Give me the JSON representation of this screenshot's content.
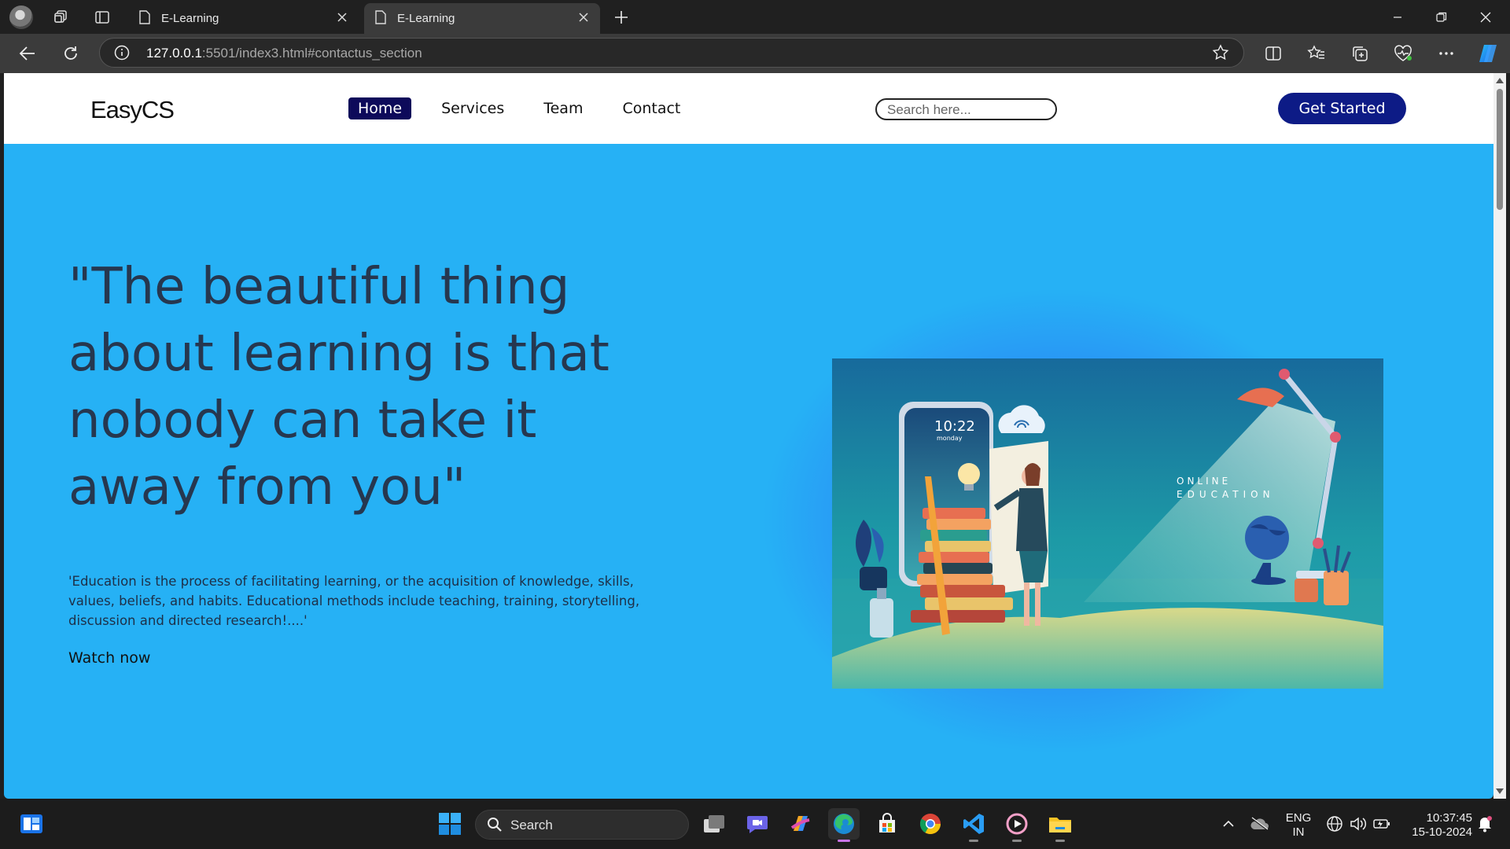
{
  "browser": {
    "tabs": [
      {
        "title": "E-Learning",
        "active": false
      },
      {
        "title": "E-Learning",
        "active": true
      }
    ],
    "address": {
      "host": "127.0.0.1",
      "rest": ":5501/index3.html#contactus_section"
    }
  },
  "site": {
    "logo": "EasyCS",
    "menu": [
      {
        "label": "Home",
        "active": true
      },
      {
        "label": "Services",
        "active": false
      },
      {
        "label": "Team",
        "active": false
      },
      {
        "label": "Contact",
        "active": false
      }
    ],
    "search_placeholder": "Search here...",
    "cta_label": "Get Started",
    "hero": {
      "quote": "\"The beautiful thing about learning is that nobody can take it away from you\"",
      "description": "'Education is the process of facilitating learning, or the acquisition of knowledge, skills, values, beliefs, and habits. Educational methods include teaching, training, storytelling, discussion and directed research!....'",
      "watch_label": "Watch now",
      "image": {
        "heading_line1": "ONLINE",
        "heading_line2": "EDUCATION",
        "clock_time": "10:22",
        "clock_day": "monday"
      }
    }
  },
  "taskbar": {
    "search_label": "Search",
    "language": {
      "line1": "ENG",
      "line2": "IN"
    },
    "time": "10:37:45",
    "date": "15-10-2024"
  },
  "colors": {
    "hero_bg": "#26b1f5",
    "nav_active": "#0d0a5a",
    "cta_bg": "#0d1b86",
    "text_dark": "#26374f"
  }
}
